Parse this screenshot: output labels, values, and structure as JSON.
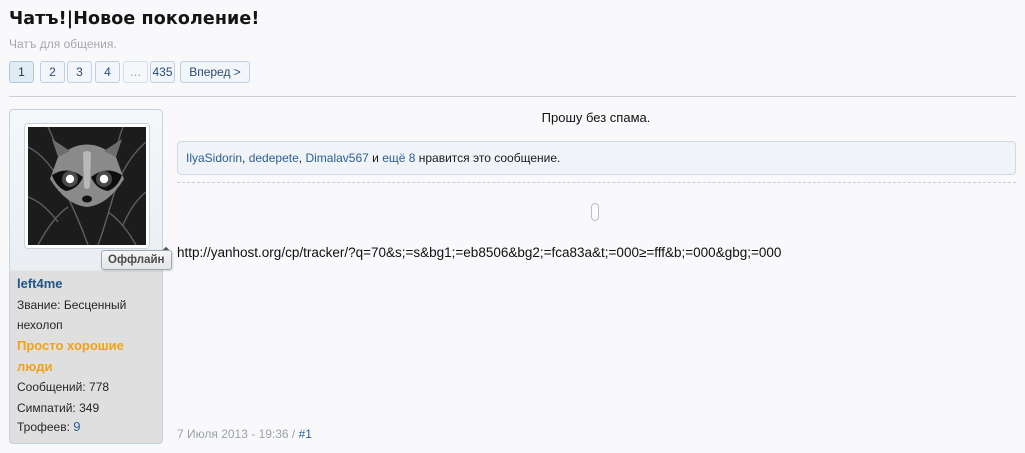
{
  "thread": {
    "title": "Чатъ!|Новое поколение!",
    "subtitle": "Чатъ для общения."
  },
  "pagination": {
    "pages": [
      "1",
      "2",
      "3",
      "4"
    ],
    "ellipsis": "…",
    "last": "435",
    "next_label": "Вперед >",
    "current": "1"
  },
  "user": {
    "status_badge": "Оффлайн",
    "username": "left4me",
    "rank_label": "Звание:",
    "rank_value": "Бесценный нехолоп",
    "group": "Просто хорошие люди",
    "messages_label": "Сообщений:",
    "messages": "778",
    "likes_label": "Симпатий:",
    "likes": "349",
    "trophies_label": "Трофеев:",
    "trophies": "9"
  },
  "post": {
    "top_text": "Прошу без спама.",
    "liked_by": [
      "IlyaSidorin",
      "dedepete",
      "Dimalav567"
    ],
    "liked_sep": ", ",
    "liked_and": " и ",
    "liked_more": "ещё 8",
    "liked_suffix": " нравится это сообщение.",
    "url_text": "http://yanhost.org/cp/tracker/?q=70&s;=s&bg1;=eb8506&bg2;=fca83a&t;=000≥=fff&b;=000&gbg;=000",
    "date": "7 Июля 2013 - 19:36",
    "date_sep": " / ",
    "permalink": "#1"
  },
  "colors": {
    "link": "#2b5f92",
    "group": "#f0a317",
    "username": "#1f5587"
  }
}
